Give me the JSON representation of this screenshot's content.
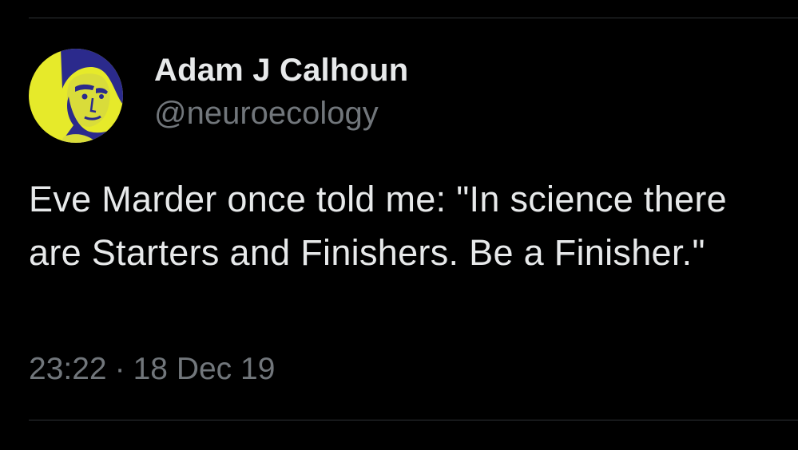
{
  "tweet": {
    "author": {
      "display_name": "Adam J Calhoun",
      "handle": "@neuroecology",
      "avatar_icon": "profile-photo-yellow-blue-duotone"
    },
    "text": "Eve Marder once told me: \"In science there are Starters and Finishers. Be a Finisher.\"",
    "timestamp": {
      "time": "23:22",
      "separator": "·",
      "date": "18 Dec 19"
    }
  },
  "colors": {
    "background": "#000000",
    "primary_text": "#e7e9ea",
    "secondary_text": "#71767b",
    "divider": "#2f3336",
    "avatar_yellow": "#e6ea2a",
    "avatar_blue": "#2b2a8c"
  }
}
